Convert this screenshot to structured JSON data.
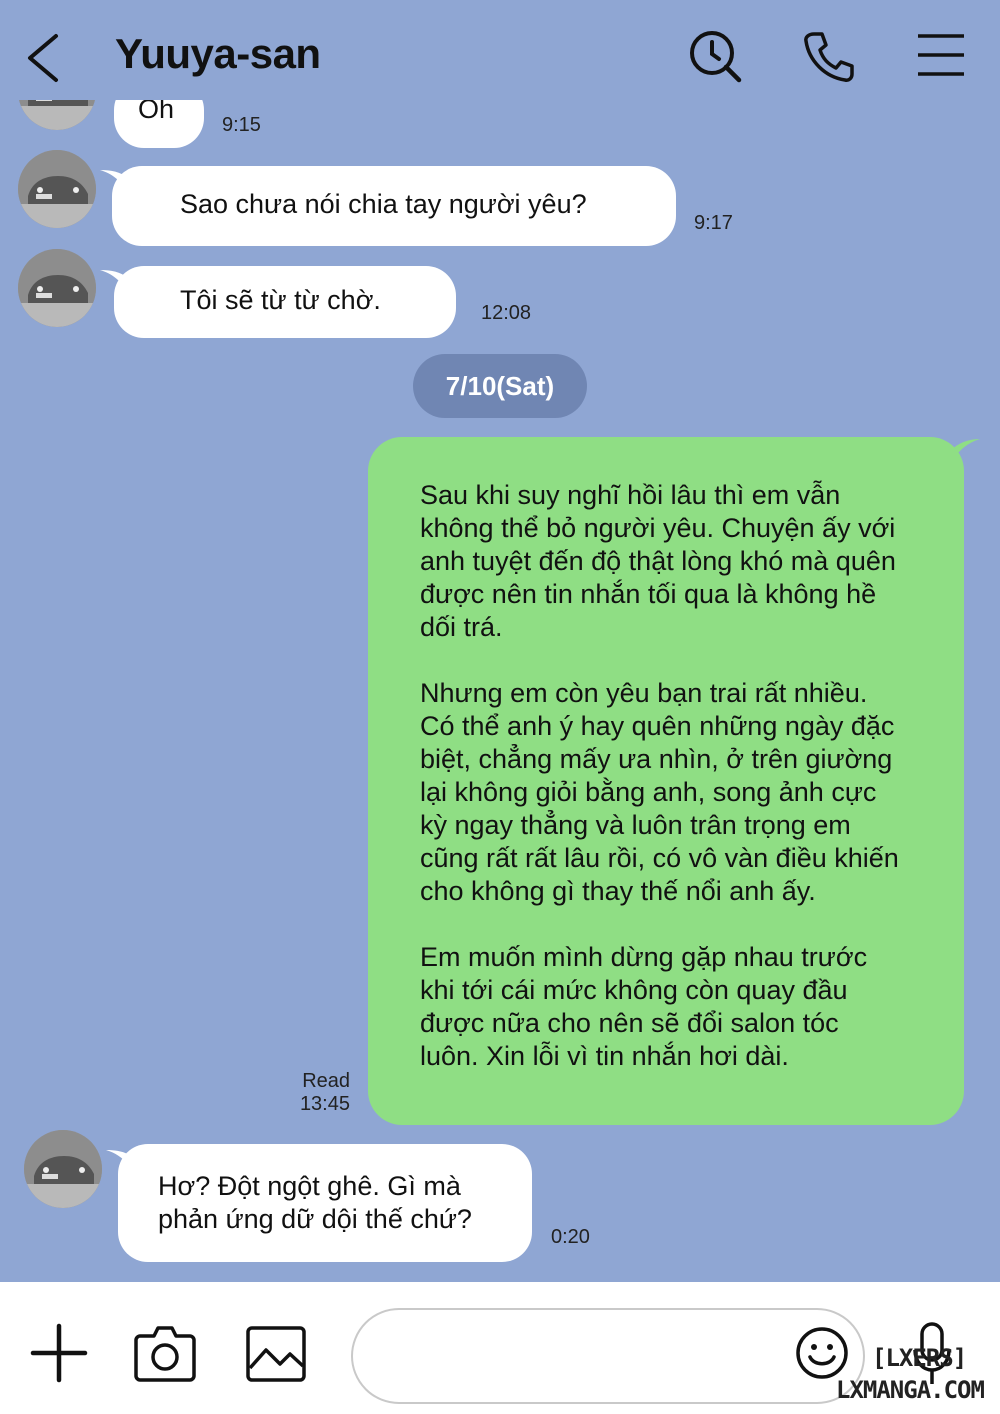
{
  "header": {
    "title": "Yuuya-san",
    "back_icon": "chevron-left-icon",
    "search_icon": "search-history-icon",
    "call_icon": "phone-icon",
    "menu_icon": "menu-icon"
  },
  "messages": [
    {
      "sender": "Yuuya-san",
      "text": "Oh",
      "time": "9:15"
    },
    {
      "sender": "Yuuya-san",
      "text": "Sao chưa nói chia tay người yêu?",
      "time": "9:17"
    },
    {
      "sender": "Yuuya-san",
      "text": "Tôi sẽ từ từ chờ.",
      "time": "12:08"
    },
    {
      "date": "7/10(Sat)"
    },
    {
      "sender": "me",
      "paragraphs": [
        "Sau khi suy nghĩ hồi lâu thì em vẫn\nkhông thể bỏ người yêu. Chuyện ấy với\nanh tuyệt đến độ thật lòng khó mà quên\nđược nên tin nhắn tối qua là không hề\ndối trá.",
        "Nhưng em còn yêu bạn trai rất nhiều.\nCó thể anh ý hay quên những ngày đặc\nbiệt, chẳng mấy ưa nhìn, ở trên giường\nlại không giỏi bằng anh, song ảnh cực\nkỳ ngay thẳng và luôn trân trọng em\ncũng rất rất lâu rồi, có vô vàn điều khiến\ncho không gì thay thế nổi anh ấy.",
        "Em muốn mình dừng gặp nhau trước\nkhi tới cái mức không còn quay đầu\nđược nữa cho nên sẽ đổi salon tóc\nluôn. Xin lỗi vì tin nhắn hơi dài."
      ],
      "status": "Read",
      "time": "13:45"
    },
    {
      "sender": "Yuuya-san",
      "text": "Hơ? Đột ngột ghê. Gì mà\nphản ứng dữ dội thế chứ?",
      "time": "0:20"
    }
  ],
  "footer": {
    "input_placeholder": "",
    "icons": [
      "plus-icon",
      "camera-icon",
      "image-icon",
      "emoji-icon",
      "microphone-icon"
    ]
  },
  "watermark": {
    "line1": "[LXERS]",
    "line2": "LXMANGA.COM"
  },
  "colors": {
    "background": "#8fa6d3",
    "sent_bubble": "#8fde84",
    "received_bubble": "#ffffff",
    "date_pill": "#7086b3"
  }
}
